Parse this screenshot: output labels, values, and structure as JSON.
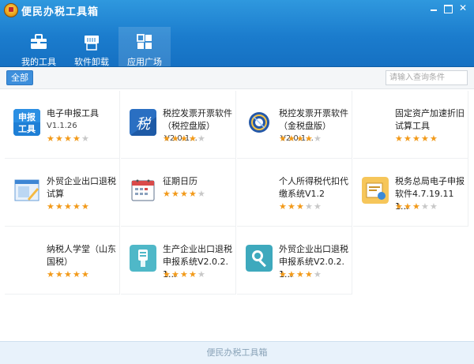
{
  "window": {
    "title": "便民办税工具箱",
    "controls": {
      "minimize": "",
      "maximize": "",
      "close": "✕"
    }
  },
  "nav": {
    "tabs": [
      {
        "label": "我的工具",
        "icon": "toolbox-icon",
        "active": false
      },
      {
        "label": "软件卸载",
        "icon": "printer-icon",
        "active": false
      },
      {
        "label": "应用广场",
        "icon": "grid-apps-icon",
        "active": true
      }
    ]
  },
  "toolbar": {
    "filter_label": "全部",
    "search_placeholder": "请输入查询条件"
  },
  "apps": [
    {
      "name": "电子申报工具",
      "version": "V1.1.26",
      "rating": 4,
      "icon": "e-filing-icon"
    },
    {
      "name": "税控发票开票软件（税控盘版）",
      "version": "V2.0.1...",
      "rating": 4,
      "icon": "tax-control-icon"
    },
    {
      "name": "税控发票开票软件（金税盘版）",
      "version": "V2.0.1...",
      "rating": 4,
      "icon": "golden-tax-icon"
    },
    {
      "name": "固定资产加速折旧试算工具",
      "version": "",
      "rating": 5,
      "icon": ""
    },
    {
      "name": "外贸企业出口退税试算",
      "version": "",
      "rating": 5,
      "icon": "export-refund-calc-icon"
    },
    {
      "name": "征期日历",
      "version": "",
      "rating": 4,
      "icon": "calendar-icon"
    },
    {
      "name": "个人所得税代扣代缴系统V1.2",
      "version": "",
      "rating": 3,
      "icon": ""
    },
    {
      "name": "税务总局电子申报软件4.7.19.111...",
      "version": "",
      "rating": 3,
      "icon": "tax-bureau-filing-icon"
    },
    {
      "name": "纳税人学堂（山东国税）",
      "version": "",
      "rating": 5,
      "icon": ""
    },
    {
      "name": "生产企业出口退税申报系统V2.0.2.1...",
      "version": "",
      "rating": 4,
      "icon": "manufacturer-refund-icon"
    },
    {
      "name": "外贸企业出口退税申报系统V2.0.2.1...",
      "version": "",
      "rating": 4,
      "icon": "trade-refund-icon"
    }
  ],
  "footer": {
    "label": "便民办税工具箱"
  },
  "colors": {
    "header": "#1b7ccd",
    "star_on": "#f29a1a",
    "star_off": "#c8c8c8",
    "footer_bg": "#e8f2fb"
  }
}
